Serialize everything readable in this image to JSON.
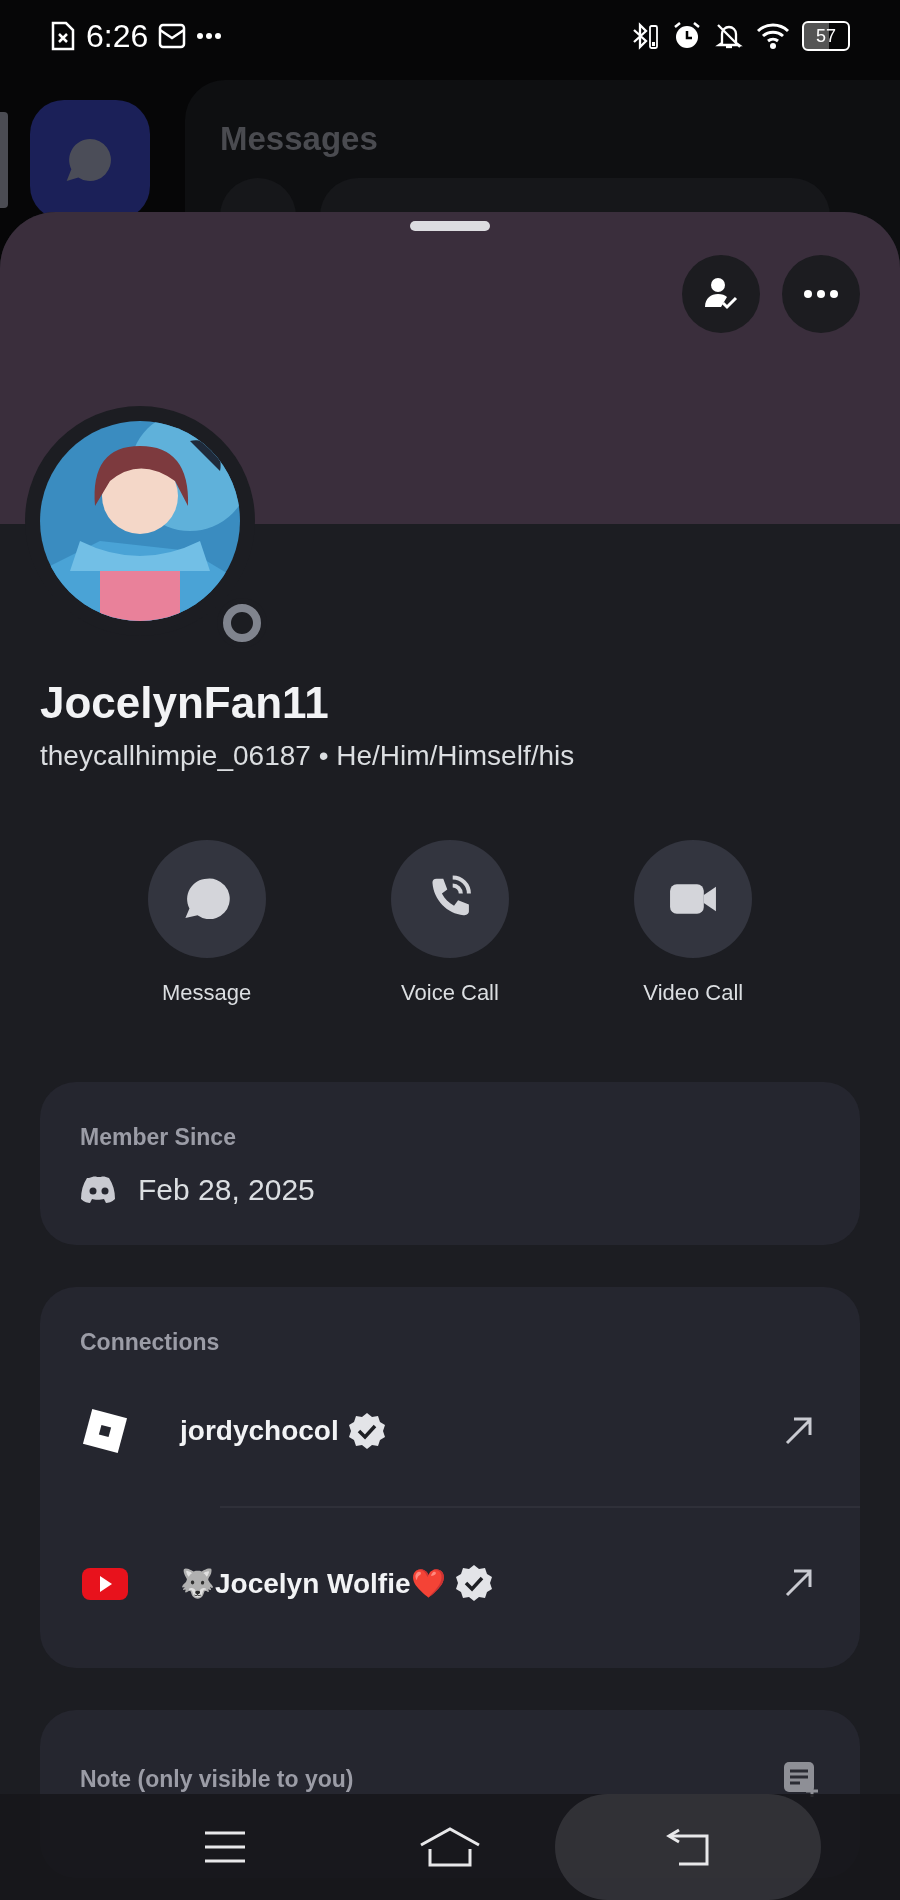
{
  "status_bar": {
    "time": "6:26",
    "battery": "57"
  },
  "background": {
    "title": "Messages"
  },
  "profile": {
    "display_name": "JocelynFan11",
    "subtitle": "theycallhimpie_06187 • He/Him/Himself/his",
    "status": {
      "kind": "offline"
    }
  },
  "actions": [
    {
      "kind": "message",
      "label": "Message"
    },
    {
      "kind": "voice",
      "label": "Voice Call"
    },
    {
      "kind": "video",
      "label": "Video Call"
    }
  ],
  "member_since": {
    "heading": "Member Since",
    "date": "Feb 28, 2025"
  },
  "connections": {
    "heading": "Connections",
    "items": [
      {
        "kind": "roblox",
        "name": "jordychocol",
        "verified": true
      },
      {
        "kind": "youtube",
        "name": "🐺Jocelyn Wolfie❤️",
        "verified": true
      }
    ]
  },
  "note": {
    "heading": "Note (only visible to you)"
  }
}
